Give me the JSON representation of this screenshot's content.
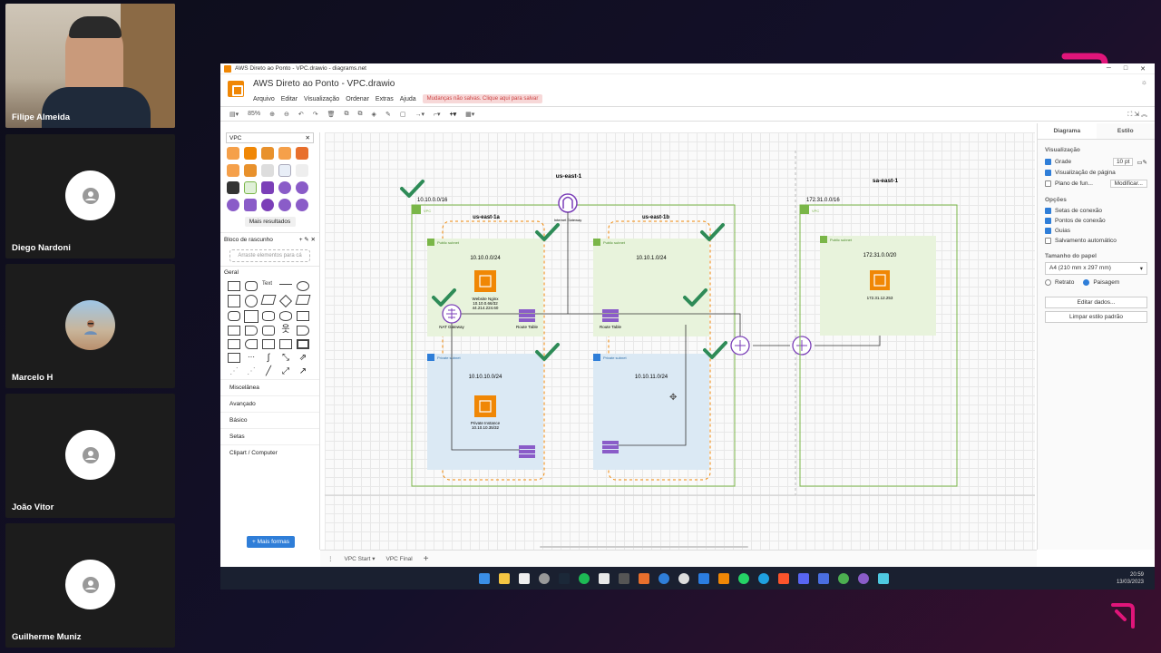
{
  "participants": [
    {
      "name": "Filipe Almeida",
      "type": "camera"
    },
    {
      "name": "Diego Nardoni",
      "type": "avatar"
    },
    {
      "name": "Marcelo H",
      "type": "photo"
    },
    {
      "name": "João Vitor",
      "type": "avatar"
    },
    {
      "name": "Guilherme Muniz",
      "type": "avatar"
    }
  ],
  "window": {
    "title": "AWS Direto ao Ponto - VPC.drawio - diagrams.net"
  },
  "app": {
    "doc_title": "AWS Direto ao Ponto - VPC.drawio",
    "menus": [
      "Arquivo",
      "Editar",
      "Visualização",
      "Ordenar",
      "Extras",
      "Ajuda"
    ],
    "unsaved_notice": "Mudanças não salvas. Clique aqui para salvar"
  },
  "toolbar": {
    "zoom": "85%"
  },
  "left_panel": {
    "search_value": "VPC",
    "more_results": "Mais resultados",
    "scratchpad": "Bloco de rascunho",
    "scratch_hint": "Arraste elementos para cá",
    "general": "Geral",
    "categories": [
      "Miscelânea",
      "Avançado",
      "Básico",
      "Setas",
      "Clipart / Computer"
    ],
    "more_shapes": "+ Mais formas"
  },
  "diagram": {
    "region_left": "us-east-1",
    "region_right": "sa-east-1",
    "vpc_left_cidr": "10.10.0.0/16",
    "vpc_right_cidr": "172.31.0.0/16",
    "vpc_label": "VPC",
    "az_a": "us-east-1a",
    "az_b": "us-east-1b",
    "public_subnet": "Public subnet",
    "private_subnet": "Private subnet",
    "pub_a_cidr": "10.10.0.0/24",
    "pub_b_cidr": "10.10.1.0/24",
    "priv_a_cidr": "10.10.10.0/24",
    "priv_b_cidr": "10.10.11.0/24",
    "sa_pub_cidr": "172.31.0.0/20",
    "igw": "Internet Gateway",
    "nat": "NAT Gateway",
    "route_table": "Route Table",
    "website": "Website Nginx",
    "website_priv_ip": "10.10.0.66/32",
    "website_pub_ip": "44.214.224.60",
    "private_instance": "Private Instance",
    "private_instance_ip": "10.10.10.35/32",
    "sa_instance_ip": "172.31.12.253"
  },
  "right_panel": {
    "tab_diagram": "Diagrama",
    "tab_style": "Estilo",
    "view_head": "Visualização",
    "grid": "Grade",
    "grid_size": "10 pt",
    "page_view": "Visualização de página",
    "background": "Plano de fun...",
    "modify": "Modificar...",
    "options_head": "Opções",
    "conn_arrows": "Setas de conexão",
    "conn_points": "Pontos de conexão",
    "guides": "Guias",
    "autosave": "Salvamento automático",
    "paper_head": "Tamanho do papel",
    "paper_value": "A4 (210 mm x 297 mm)",
    "portrait": "Retrato",
    "landscape": "Paisagem",
    "edit_data": "Editar dados...",
    "clear_style": "Limpar estilo padrão"
  },
  "pages": [
    "VPC Start",
    "VPC Final"
  ],
  "clock": {
    "time": "20:59",
    "date": "13/03/2023"
  },
  "colors": {
    "check": "#2e8b57",
    "aws_orange": "#f08705",
    "public_fill": "#e8f3dc",
    "private_fill": "#dbe9f4",
    "vpc_border": "#7ab648",
    "brand": "#e0157a"
  }
}
